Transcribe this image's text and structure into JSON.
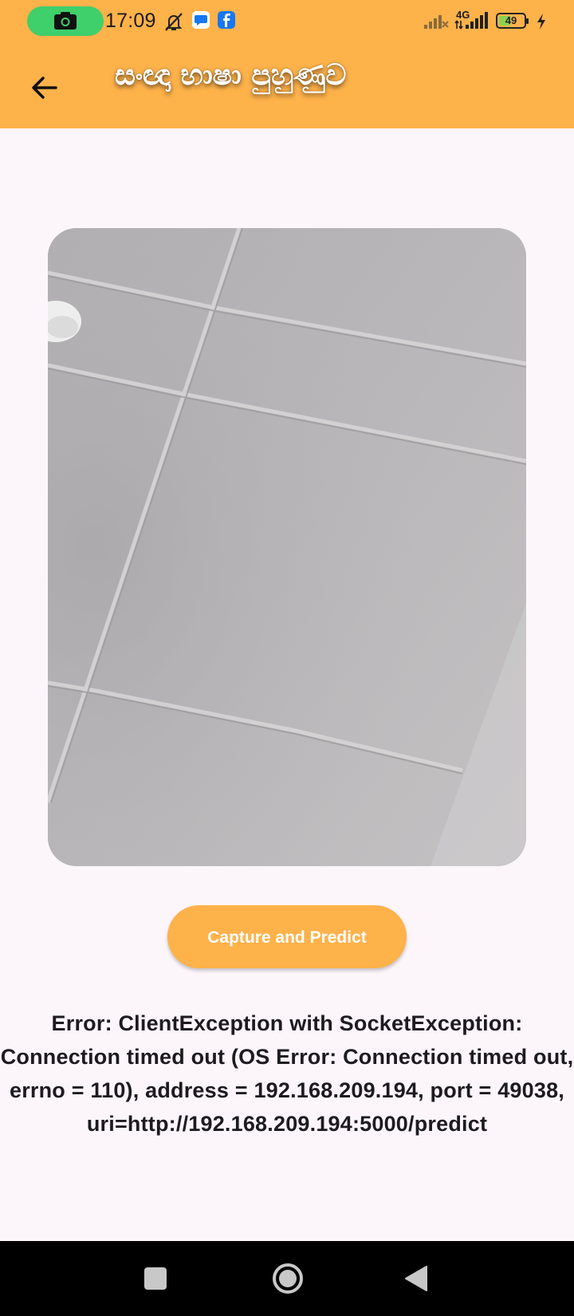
{
  "status_bar": {
    "time": "17:09",
    "network": "4G",
    "battery": "49",
    "battery_level": 0.49,
    "icons": [
      "camera-icon",
      "muted-bell-icon",
      "messenger-icon",
      "facebook-icon",
      "signal-weak-icon",
      "signal-strong-icon",
      "battery-icon",
      "charging-icon"
    ]
  },
  "app_bar": {
    "title": "සංඥා භාෂා පුහුණුව",
    "back_icon": "arrow-left-icon"
  },
  "main": {
    "capture_button_label": "Capture and Predict",
    "error_message": "Error: ClientException with SocketException: Connection timed out (OS Error: Connection timed out, errno = 110), address = 192.168.209.194, port = 49038, uri=http://192.168.209.194:5000/predict"
  },
  "nav_bar": {
    "icons": [
      "recents-square-icon",
      "home-circle-icon",
      "back-triangle-icon"
    ]
  },
  "colors": {
    "accent": "#feb24a",
    "background": "#fcf6fb",
    "camera_pill": "#3fcf6b"
  }
}
